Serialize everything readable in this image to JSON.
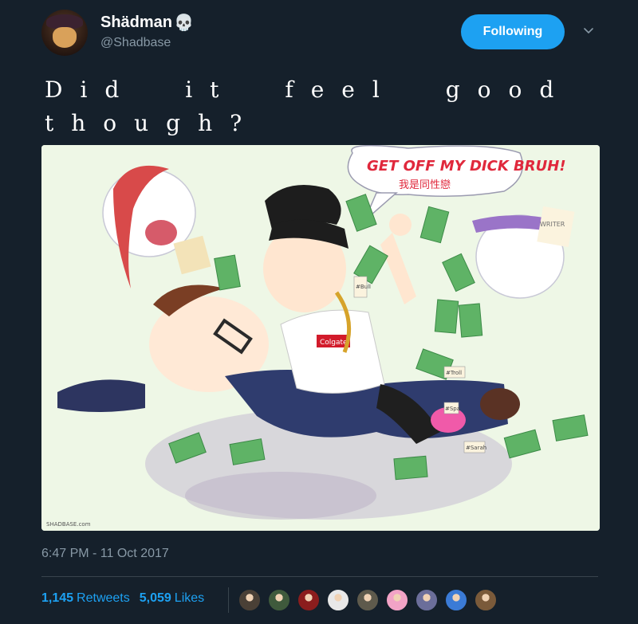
{
  "user": {
    "display_name": "Shädman",
    "name_emoji": "💀",
    "handle": "@Shadbase"
  },
  "follow_button": {
    "label": "Following"
  },
  "tweet": {
    "text": "Did it feel good though?",
    "image_caption": {
      "speech_line1": "GET OFF MY DICK BRUH!",
      "speech_line2": "我是同性戀",
      "tag_writer": "WRITER",
      "shirt_logo": "Colgate",
      "tag_1": "#Bull",
      "tag_2": "#Troll",
      "tag_3": "#Sarah",
      "tag_4": "#Spa",
      "signature": "SHADBASE.com"
    },
    "timestamp": "6:47 PM - 11 Oct 2017"
  },
  "stats": {
    "retweets_count": "1,145",
    "retweets_label": "Retweets",
    "likes_count": "5,059",
    "likes_label": "Likes"
  },
  "likers": [
    {
      "icon": "liker-avatar",
      "color": "#4a4036"
    },
    {
      "icon": "liker-avatar",
      "color": "#3f5a3c"
    },
    {
      "icon": "liker-avatar",
      "color": "#8b1d1d"
    },
    {
      "icon": "liker-avatar",
      "color": "#e8e8e8"
    },
    {
      "icon": "liker-avatar",
      "color": "#5e5a4c"
    },
    {
      "icon": "liker-avatar",
      "color": "#f2a3c6"
    },
    {
      "icon": "liker-avatar",
      "color": "#6b6e9a"
    },
    {
      "icon": "liker-avatar",
      "color": "#3b7bd6"
    },
    {
      "icon": "liker-avatar",
      "color": "#7a5a3a"
    }
  ],
  "colors": {
    "background": "#15202b",
    "accent": "#1da1f2",
    "muted": "#8899a6",
    "divider": "#38444d"
  }
}
